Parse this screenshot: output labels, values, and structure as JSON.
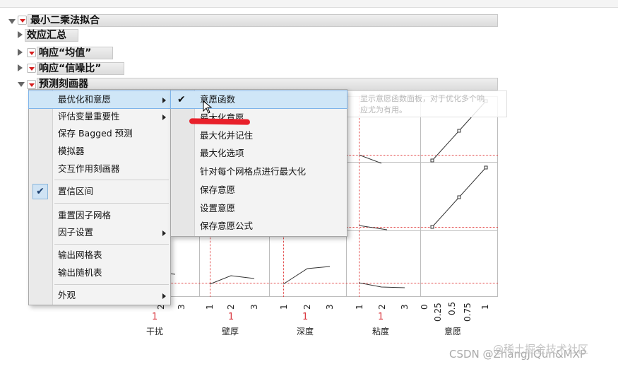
{
  "report": {
    "title": "最小二乘法拟合",
    "sections": [
      "效应汇总",
      "响应“均值”",
      "响应“信噪比”",
      "预测刻画器"
    ]
  },
  "context_menu": {
    "items": [
      {
        "label": "最优化和意愿",
        "submenu": true
      },
      {
        "label": "评估变量重要性",
        "submenu": true
      },
      {
        "label": "保存 Bagged 预测"
      },
      {
        "label": "模拟器"
      },
      {
        "label": "交互作用刻画器"
      },
      {
        "label": "置信区间",
        "checked": true
      },
      {
        "label": "重置因子网格"
      },
      {
        "label": "因子设置",
        "submenu": true
      },
      {
        "label": "输出网格表"
      },
      {
        "label": "输出随机表"
      },
      {
        "label": "外观",
        "submenu": true
      }
    ]
  },
  "submenu": {
    "items": [
      {
        "label": "意愿函数",
        "checked": true
      },
      {
        "label": "最大化意愿"
      },
      {
        "label": "最大化并记住"
      },
      {
        "label": "最大化选项"
      },
      {
        "label": "针对每个网格点进行最大化"
      },
      {
        "label": "保存意愿"
      },
      {
        "label": "设置意愿"
      },
      {
        "label": "保存意愿公式"
      }
    ]
  },
  "tooltip": {
    "line1": "显示意愿函数面板，对于优化多个响",
    "line2": "应尤为有用。"
  },
  "profiler": {
    "factors": [
      {
        "name": "干扰",
        "current": "1",
        "ticks": [
          "1",
          "2",
          "3"
        ]
      },
      {
        "name": "壁厚",
        "current": "1",
        "ticks": [
          "1",
          "2",
          "3"
        ]
      },
      {
        "name": "深度",
        "current": "1",
        "ticks": [
          "1",
          "2",
          "3"
        ]
      },
      {
        "name": "粘度",
        "current": "1",
        "ticks": [
          "1",
          "2",
          "3"
        ]
      },
      {
        "name": "意愿",
        "current": "",
        "ticks": [
          "0",
          "0.25",
          "0.5",
          "0.75",
          "1"
        ]
      }
    ]
  },
  "watermark": {
    "csdn": "CSDN @ZhangJiQun&MXP",
    "juejin": "@稀土掘金技术社区"
  },
  "colors": {
    "accent_red": "#d9363e",
    "menu_highlight": "#cfe6f7"
  }
}
